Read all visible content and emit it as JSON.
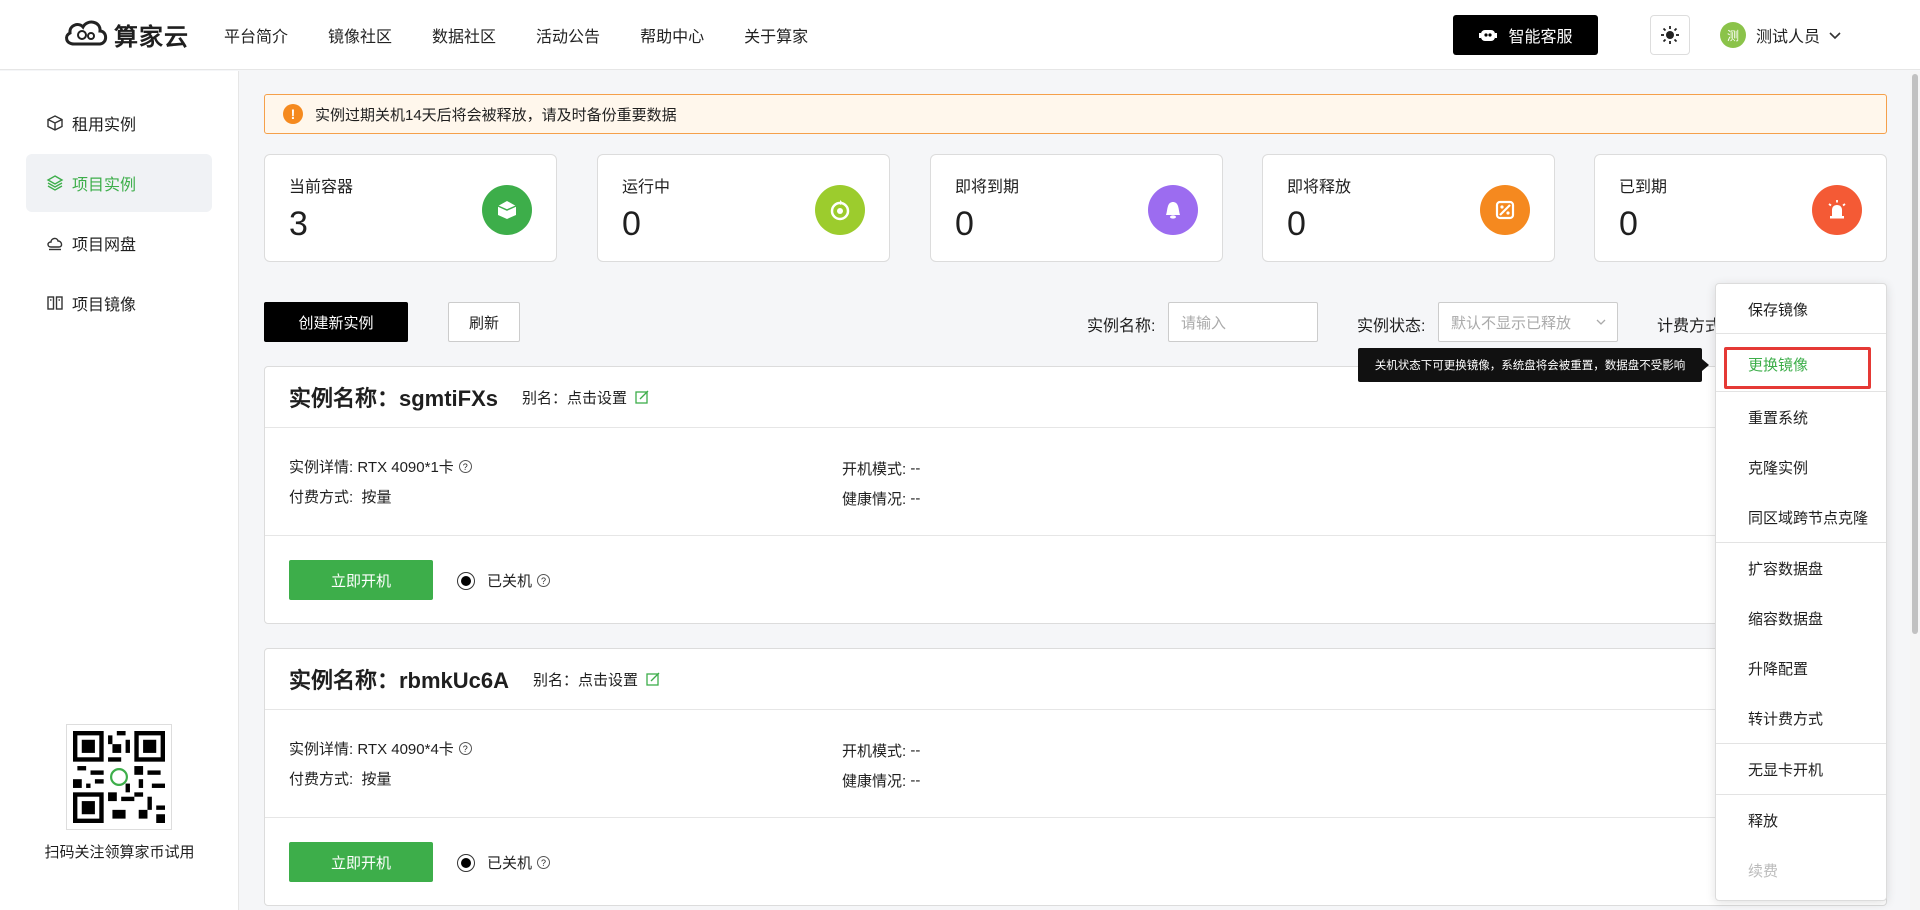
{
  "header": {
    "logo_text": "算家云",
    "nav": [
      "平台简介",
      "镜像社区",
      "数据社区",
      "活动公告",
      "帮助中心",
      "关于算家"
    ],
    "service_label": "智能客服",
    "user_avatar": "测",
    "user_name": "测试人员"
  },
  "sidebar": {
    "items": [
      {
        "label": "租用实例",
        "icon": "cube-icon"
      },
      {
        "label": "项目实例",
        "icon": "layers-icon"
      },
      {
        "label": "项目网盘",
        "icon": "cloud-drive-icon"
      },
      {
        "label": "项目镜像",
        "icon": "image-icon"
      }
    ],
    "active_index": 1,
    "qr_caption": "扫码关注领算家币试用"
  },
  "notice": {
    "text": "实例过期关机14天后将会被释放，请及时备份重要数据"
  },
  "stats": [
    {
      "label": "当前容器",
      "value": "3",
      "color": "#3dae4a"
    },
    {
      "label": "运行中",
      "value": "0",
      "color": "#9ccc2d"
    },
    {
      "label": "即将到期",
      "value": "0",
      "color": "#9c6cf0"
    },
    {
      "label": "即将释放",
      "value": "0",
      "color": "#f5891f"
    },
    {
      "label": "已到期",
      "value": "0",
      "color": "#f45a35"
    }
  ],
  "toolbar": {
    "create_label": "创建新实例",
    "refresh_label": "刷新",
    "name_label": "实例名称:",
    "name_placeholder": "请输入",
    "status_label": "实例状态:",
    "status_value": "默认不显示已释放",
    "billing_label": "计费方式"
  },
  "instances": [
    {
      "title": "实例名称：sgmtiFXs",
      "alias": "别名：点击设置",
      "detail_label": "实例详情:",
      "detail_value": "RTX 4090*1卡",
      "pay_label": "付费方式:",
      "pay_value": "按量",
      "boot_label": "开机模式:",
      "boot_value": "--",
      "health_label": "健康情况:",
      "health_value": "--",
      "start_label": "立即开机",
      "status": "已关机"
    },
    {
      "title": "实例名称：rbmkUc6A",
      "alias": "别名：点击设置",
      "detail_label": "实例详情:",
      "detail_value": "RTX 4090*4卡",
      "pay_label": "付费方式:",
      "pay_value": "按量",
      "boot_label": "开机模式:",
      "boot_value": "--",
      "health_label": "健康情况:",
      "health_value": "--",
      "start_label": "立即开机",
      "status": "已关机"
    }
  ],
  "tooltip": "关机状态下可更换镜像，系统盘将会被重置，数据盘不受影响",
  "menu": [
    {
      "label": "保存镜像"
    },
    {
      "label": "更换镜像",
      "highlighted": true
    },
    {
      "label": "重置系统"
    },
    {
      "label": "克隆实例"
    },
    {
      "label": "同区域跨节点克隆"
    },
    {
      "label": "扩容数据盘"
    },
    {
      "label": "缩容数据盘"
    },
    {
      "label": "升降配置"
    },
    {
      "label": "转计费方式"
    },
    {
      "label": "无显卡开机"
    },
    {
      "label": "释放"
    },
    {
      "label": "续费",
      "disabled": true
    }
  ],
  "colors": {
    "accent": "#3dae4a",
    "highlight_border": "#e53935",
    "notice_border": "#f5a04a"
  }
}
